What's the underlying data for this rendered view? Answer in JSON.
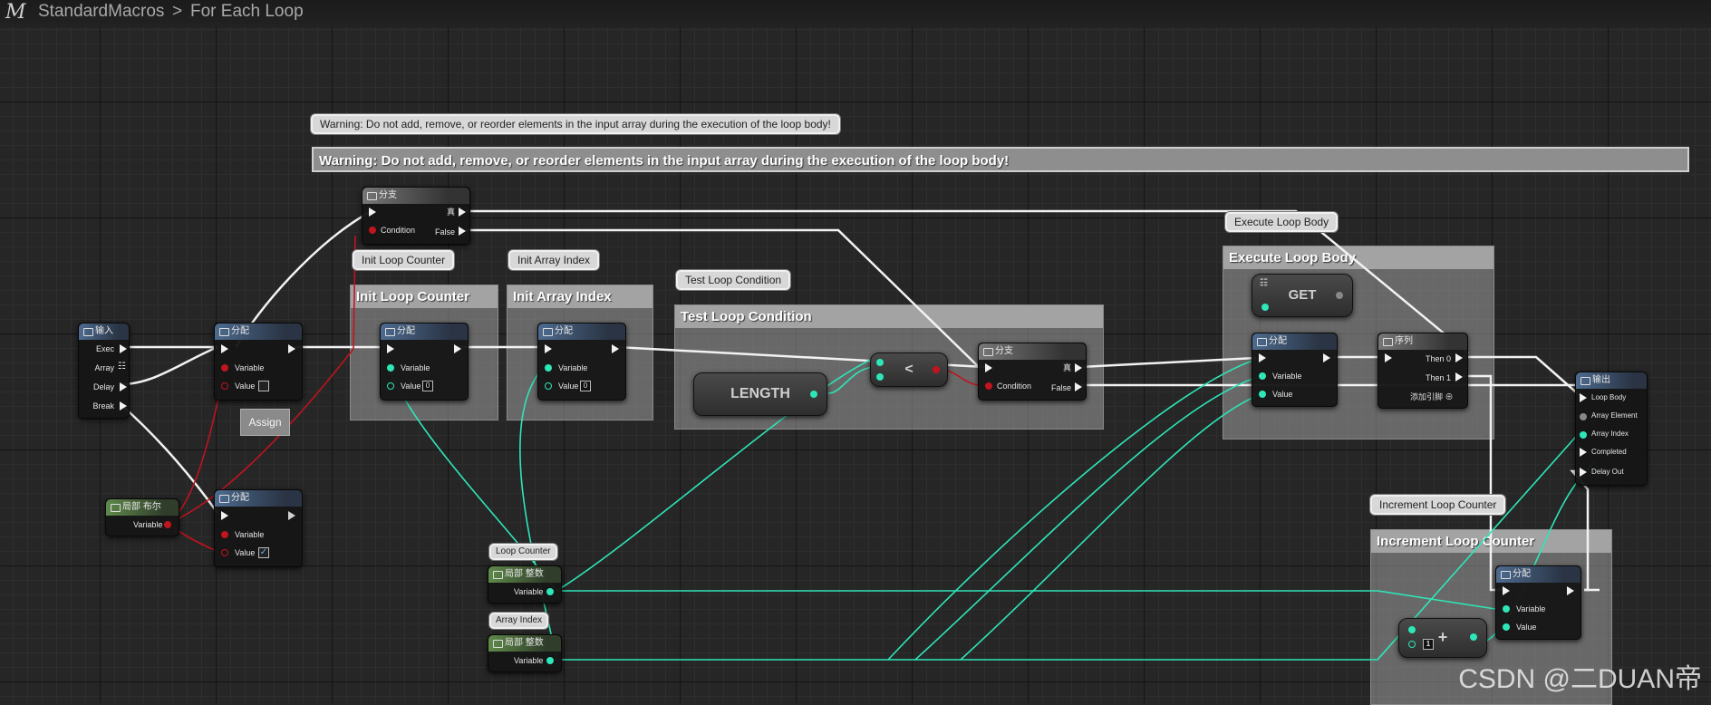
{
  "breadcrumb": {
    "logo": "M",
    "root": "StandardMacros",
    "separator": ">",
    "current": "For Each Loop"
  },
  "warning": {
    "bubble": "Warning: Do not add, remove, or reorder elements in the input array during the execution of the loop body!",
    "bar": "Warning: Do not add, remove, or reorder elements in the input array during the execution of the loop body!"
  },
  "comments": {
    "init_loop_counter": "Init Loop Counter",
    "init_array_index": "Init Array Index",
    "test_loop_condition": "Test Loop Condition",
    "execute_loop_body": "Execute Loop Body",
    "increment_loop_counter": "Increment Loop Counter"
  },
  "nodes": {
    "input": {
      "title": "输入",
      "pins": [
        "Exec",
        "Array",
        "Delay",
        "Break"
      ]
    },
    "branch_top": {
      "title": "分支",
      "condition": "Condition",
      "true_label": "真",
      "false_label": "False"
    },
    "assign_a": {
      "title": "分配",
      "variable": "Variable",
      "value": "Value"
    },
    "assign_label": "Assign",
    "assign_init_counter": {
      "title": "分配",
      "variable": "Variable",
      "value": "Value",
      "value_default": "0"
    },
    "assign_init_index": {
      "title": "分配",
      "variable": "Variable",
      "value": "Value",
      "value_default": "0"
    },
    "length": {
      "label": "LENGTH"
    },
    "less": {
      "label": "<"
    },
    "branch_mid": {
      "title": "分支",
      "condition": "Condition",
      "true_label": "真",
      "false_label": "False"
    },
    "get": {
      "label": "GET"
    },
    "assign_exec": {
      "title": "分配",
      "variable": "Variable",
      "value": "Value"
    },
    "sequence": {
      "title": "序列",
      "then0": "Then 0",
      "then1": "Then 1",
      "add_pin": "添加引脚"
    },
    "output": {
      "title": "输出",
      "pins": [
        "Loop Body",
        "Array Element",
        "Array Index",
        "Completed",
        "Delay Out"
      ]
    },
    "local_bool": {
      "title": "局部 布尔",
      "variable": "Variable"
    },
    "assign_bool": {
      "title": "分配",
      "variable": "Variable",
      "value": "Value"
    },
    "local_int_counter": {
      "bubble": "Loop Counter",
      "title": "局部 整数",
      "variable": "Variable"
    },
    "local_int_index": {
      "bubble": "Array Index",
      "title": "局部 整数",
      "variable": "Variable"
    },
    "plus": {
      "label": "+",
      "value_default": "1"
    },
    "assign_inc": {
      "title": "分配",
      "variable": "Variable",
      "value": "Value"
    }
  },
  "icons": [
    "function-icon",
    "branch-icon",
    "sequence-icon",
    "exec-pin-icon",
    "data-pin-icon",
    "checkbox-icon"
  ],
  "colors": {
    "exec_wire": "#f2f2f2",
    "int_wire": "#2ee6b8",
    "bool_wire": "#c0141e",
    "background": "#262626"
  },
  "watermark": "CSDN @二DUAN帝"
}
